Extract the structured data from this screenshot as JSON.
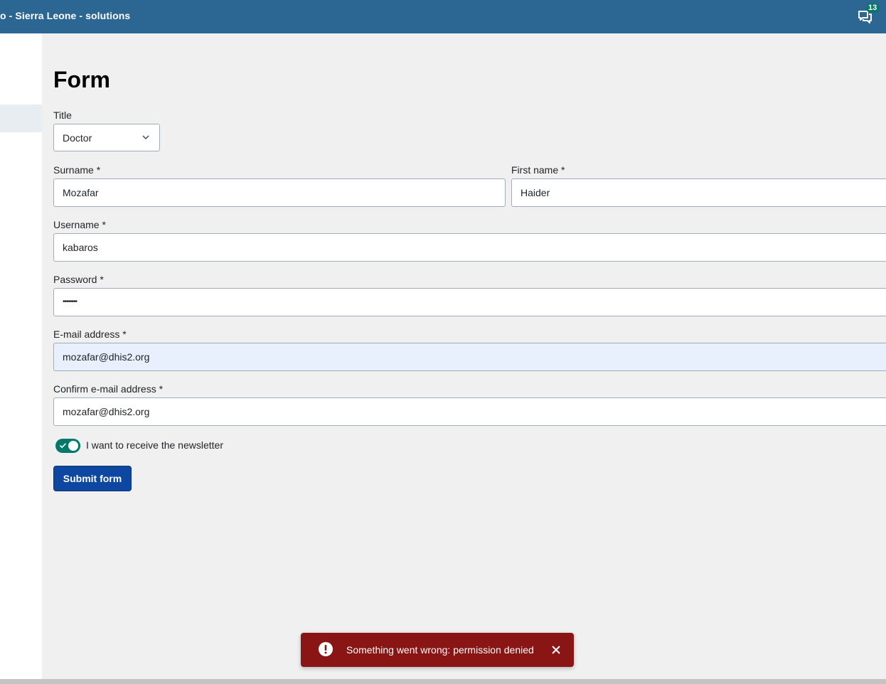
{
  "header": {
    "app_title": "o - Sierra Leone - solutions",
    "messages_badge": "13",
    "messages_icon": "messages-icon"
  },
  "form": {
    "title": "Form",
    "title_field": {
      "label": "Title",
      "value": "Doctor"
    },
    "surname": {
      "label": "Surname *",
      "value": "Mozafar"
    },
    "first_name": {
      "label": "First name *",
      "value": "Haider"
    },
    "username": {
      "label": "Username *",
      "value": "kabaros"
    },
    "password": {
      "label": "Password *",
      "value": "••••••••"
    },
    "email": {
      "label": "E-mail address *",
      "value": "mozafar@dhis2.org"
    },
    "confirm_email": {
      "label": "Confirm e-mail address *",
      "value": "mozafar@dhis2.org"
    },
    "newsletter": {
      "label": "I want to receive the newsletter",
      "checked": true
    },
    "submit_label": "Submit form"
  },
  "alert": {
    "message": "Something went wrong: permission denied",
    "icon": "error-icon"
  },
  "colors": {
    "header": "#2c6693",
    "primary_button": "#0d47a1",
    "toggle_on": "#00796b",
    "alert_critical": "#891515"
  }
}
